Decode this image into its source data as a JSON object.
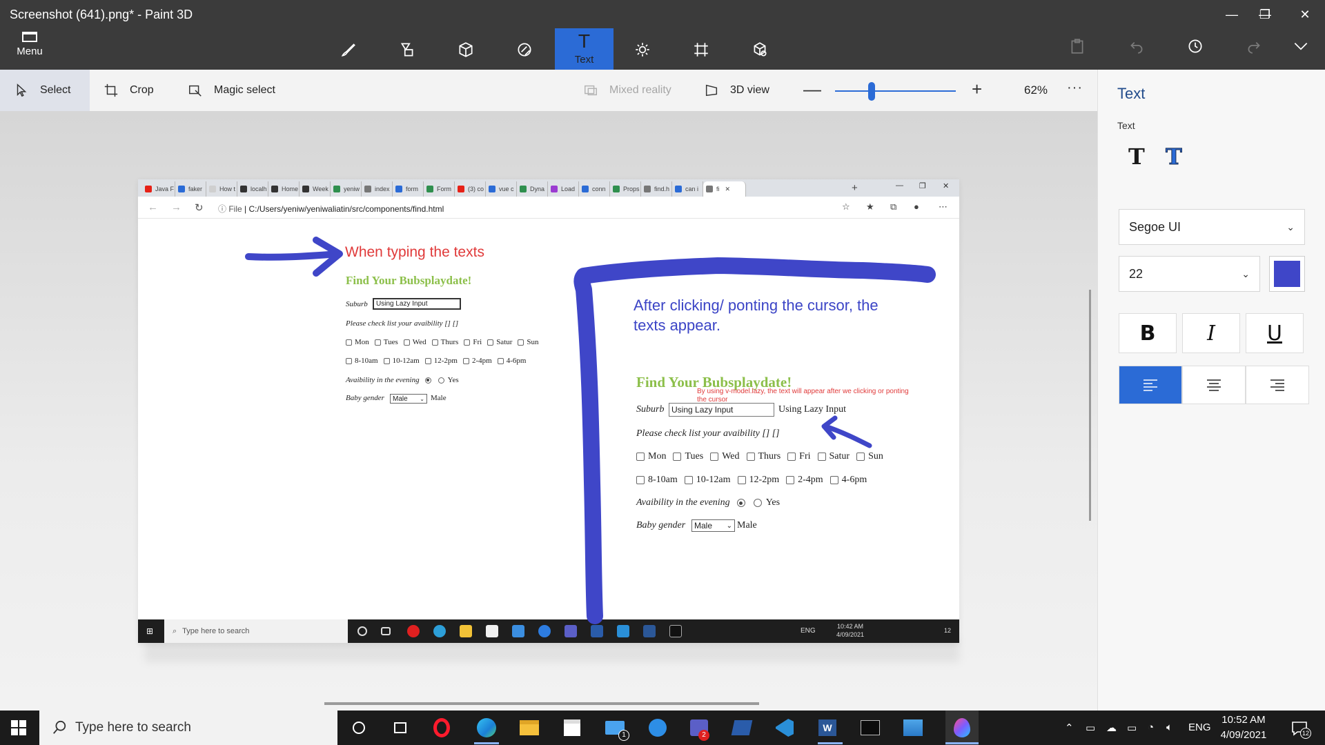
{
  "app": {
    "title": "Screenshot (641).png* - Paint 3D",
    "menu_label": "Menu",
    "active_tool_label": "Text",
    "window_controls": {
      "minimize": "—",
      "restore": "❐",
      "close": "✕"
    }
  },
  "toolbar": {
    "select_label": "Select",
    "crop_label": "Crop",
    "magic_select_label": "Magic select",
    "mixed_reality_label": "Mixed reality",
    "view3d_label": "3D view",
    "zoom_minus": "—",
    "zoom_plus": "+",
    "zoom_level": "62%",
    "zoom_fraction": 0.3,
    "more_label": "···"
  },
  "panel": {
    "title": "Text",
    "text_type_label": "Text",
    "font_family": "Segoe UI",
    "font_size": "22",
    "text_color": "#3f46c8",
    "bold_label": "B",
    "italic_label": "I",
    "underline_label": "U"
  },
  "browser": {
    "tabs": [
      {
        "label": "Java F",
        "color": "#e62117"
      },
      {
        "label": "faker",
        "color": "#2b6bd6"
      },
      {
        "label": "How t",
        "color": "#cfcfcf"
      },
      {
        "label": "localh",
        "color": "#333333"
      },
      {
        "label": "Home",
        "color": "#333333"
      },
      {
        "label": "Week",
        "color": "#333333"
      },
      {
        "label": "yeniw",
        "color": "#2f8f4e"
      },
      {
        "label": "index",
        "color": "#777777"
      },
      {
        "label": "form",
        "color": "#2b6bd6"
      },
      {
        "label": "Form",
        "color": "#2f8f4e"
      },
      {
        "label": "(3) co",
        "color": "#e62117"
      },
      {
        "label": "vue c",
        "color": "#2b6bd6"
      },
      {
        "label": "Dyna",
        "color": "#2f8f4e"
      },
      {
        "label": "Load",
        "color": "#9b3bd1"
      },
      {
        "label": "conn",
        "color": "#2b6bd6"
      },
      {
        "label": "Props",
        "color": "#2f8f4e"
      },
      {
        "label": "find.h",
        "color": "#777777"
      },
      {
        "label": "can i",
        "color": "#2b6bd6"
      },
      {
        "label": "fi",
        "color": "#777777"
      }
    ],
    "tab_close": "✕",
    "new_tab": "+",
    "url_prefix": "File",
    "url": "C:/Users/yeniw/yeniwaliatin/src/components/find.html"
  },
  "annotations": {
    "typing": "When typing the texts",
    "after_click": "After clicking/ ponting the cursor, the texts appear.",
    "lazy_note": "By using v-model.lazy, the text will appear after we clicking or ponting the cursor"
  },
  "form": {
    "title": "Find Your Bubsplaydate!",
    "suburb_label": "Suburb",
    "suburb_value": "Using Lazy Input",
    "suburb_echo": "Using Lazy Input",
    "checklist_label": "Please check list your avaibility [] []",
    "days": [
      "Mon",
      "Tues",
      "Wed",
      "Thurs",
      "Fri",
      "Satur",
      "Sun"
    ],
    "times": [
      "8-10am",
      "10-12am",
      "12-2pm",
      "2-4pm",
      "4-6pm"
    ],
    "evening_label": "Avaibility in the evening",
    "evening_option": "Yes",
    "gender_label": "Baby gender",
    "gender_value": "Male",
    "gender_echo": "Male"
  },
  "inner_taskbar": {
    "search_placeholder": "Type here to search",
    "lang": "ENG",
    "time": "10:42 AM",
    "date": "4/09/2021",
    "notifications": "12"
  },
  "taskbar": {
    "search_placeholder": "Type here to search",
    "lang": "ENG",
    "time": "10:52 AM",
    "date": "4/09/2021",
    "notifications": "12",
    "mail_badge": "1",
    "teams_badge": "2"
  }
}
